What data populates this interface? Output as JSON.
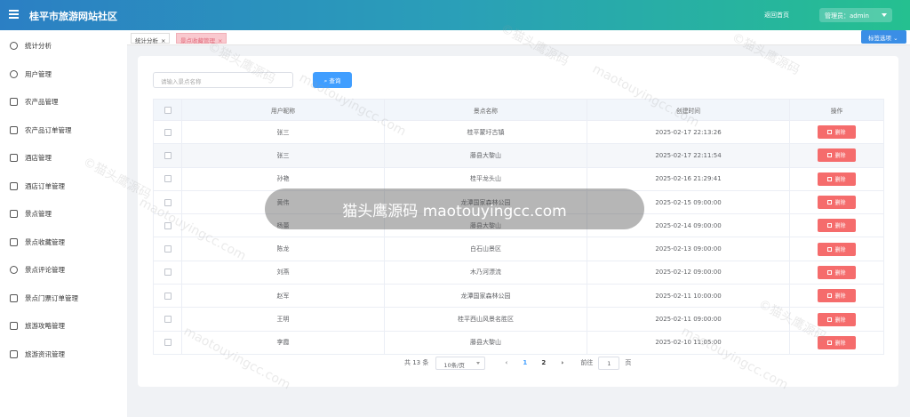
{
  "header": {
    "title": "桂平市旅游网站社区",
    "home_link": "返回首页",
    "admin_label": "管理员：admin"
  },
  "sidebar": {
    "items": [
      {
        "label": "统计分析",
        "icon": "user-icon"
      },
      {
        "label": "用户管理",
        "icon": "user-icon"
      },
      {
        "label": "农产品管理",
        "icon": "box-icon"
      },
      {
        "label": "农产品订单管理",
        "icon": "list-icon"
      },
      {
        "label": "酒店管理",
        "icon": "building-icon"
      },
      {
        "label": "酒店订单管理",
        "icon": "card-icon"
      },
      {
        "label": "景点管理",
        "icon": "copy-icon"
      },
      {
        "label": "景点收藏管理",
        "icon": "star-icon"
      },
      {
        "label": "景点评论管理",
        "icon": "chat-icon"
      },
      {
        "label": "景点门票订单管理",
        "icon": "ticket-icon"
      },
      {
        "label": "旅游攻略管理",
        "icon": "doc-icon"
      },
      {
        "label": "旅游资讯管理",
        "icon": "doc-icon"
      }
    ]
  },
  "tabs": {
    "items": [
      {
        "label": "统计分析"
      },
      {
        "label": "景点收藏管理"
      }
    ],
    "options_label": "标签选项"
  },
  "search": {
    "placeholder": "请输入景点名称",
    "button": "查询"
  },
  "table": {
    "headers": [
      "用户昵称",
      "景点名称",
      "创建时间",
      "操作"
    ],
    "delete_label": "删除",
    "rows": [
      {
        "user": "张三",
        "spot": "桂平蒙圩古镇",
        "time": "2025-02-17 22:13:26"
      },
      {
        "user": "张三",
        "spot": "藤县大黎山",
        "time": "2025-02-17 22:11:54"
      },
      {
        "user": "孙艳",
        "spot": "桂平龙头山",
        "time": "2025-02-16 21:29:41"
      },
      {
        "user": "黄伟",
        "spot": "龙潭国家森林公园",
        "time": "2025-02-15 09:00:00"
      },
      {
        "user": "杨蕾",
        "spot": "藤县大黎山",
        "time": "2025-02-14 09:00:00"
      },
      {
        "user": "陈龙",
        "spot": "白石山景区",
        "time": "2025-02-13 09:00:00"
      },
      {
        "user": "刘燕",
        "spot": "木乃河漂流",
        "time": "2025-02-12 09:00:00"
      },
      {
        "user": "赵军",
        "spot": "龙潭国家森林公园",
        "time": "2025-02-11 10:00:00"
      },
      {
        "user": "王明",
        "spot": "桂平西山风景名胜区",
        "time": "2025-02-11 09:00:00"
      },
      {
        "user": "李霞",
        "spot": "藤县大黎山",
        "time": "2025-02-10 11:05:00"
      }
    ]
  },
  "pagination": {
    "total": "共 13 条",
    "page_size": "10条/页",
    "pages": [
      "1",
      "2"
    ],
    "current": "1",
    "goto_label": "前往",
    "goto_value": "1",
    "page_unit": "页"
  },
  "watermark": {
    "text": "©猫头鹰源码",
    "url": "maotouyingcc.com",
    "toast": "猫头鹰源码 maotouyingcc.com"
  },
  "colors": {
    "header_start": "#2b7fc4",
    "header_end": "#25c090",
    "primary": "#409eff",
    "danger": "#f56c6c"
  }
}
